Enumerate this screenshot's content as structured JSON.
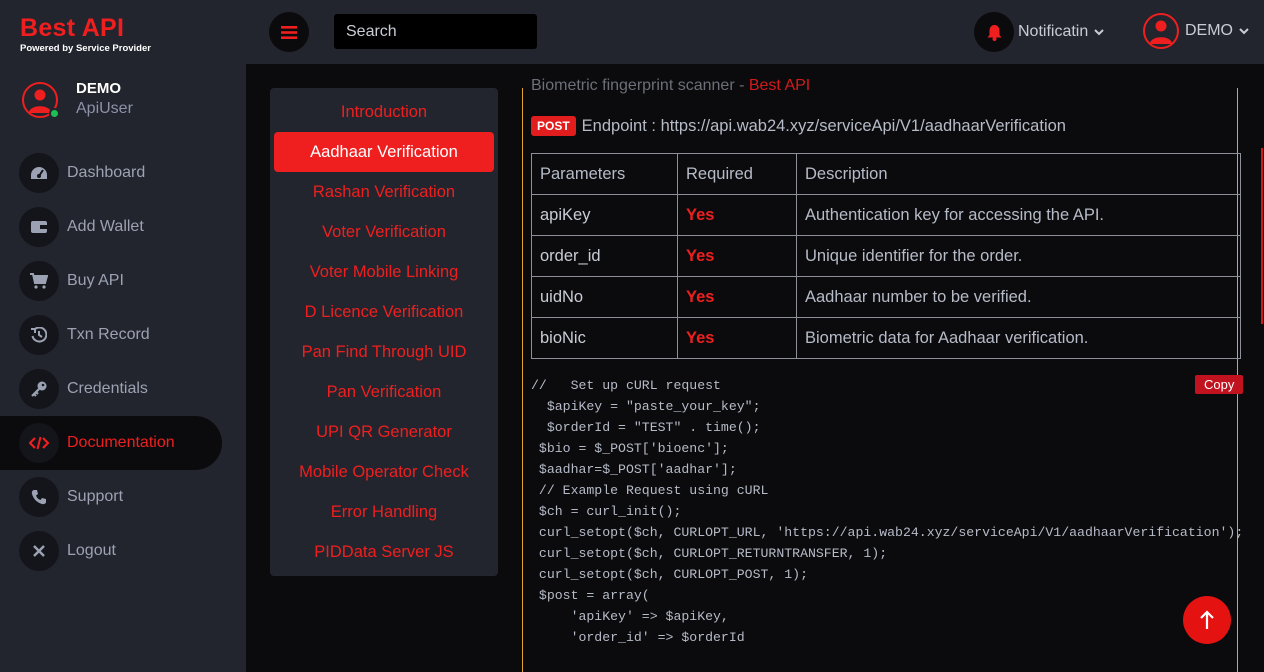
{
  "brand": {
    "title": "Best API",
    "subtitle": "Powered by Service Provider"
  },
  "user": {
    "name": "DEMO",
    "role": "ApiUser"
  },
  "sidebar": {
    "items": [
      {
        "label": "Dashboard",
        "icon": "dashboard-icon"
      },
      {
        "label": "Add Wallet",
        "icon": "wallet-icon"
      },
      {
        "label": "Buy API",
        "icon": "cart-icon"
      },
      {
        "label": "Txn Record",
        "icon": "history-icon"
      },
      {
        "label": "Credentials",
        "icon": "key-icon"
      },
      {
        "label": "Documentation",
        "icon": "code-icon",
        "active": true
      },
      {
        "label": "Support",
        "icon": "phone-icon"
      },
      {
        "label": "Logout",
        "icon": "close-icon"
      }
    ]
  },
  "topbar": {
    "search_placeholder": "Search",
    "notification_label": "Notificatin",
    "account_label": "DEMO"
  },
  "doc_nav": {
    "items": [
      "Introduction",
      "Aadhaar Verification",
      "Rashan Verification",
      "Voter Verification",
      "Voter Mobile Linking",
      "D Licence Verification",
      "Pan Find Through UID",
      "Pan Verification",
      "UPI QR Generator",
      "Mobile Operator Check",
      "Error Handling",
      "PIDData Server JS"
    ],
    "active_index": 1
  },
  "content": {
    "faded_text": "Biometric fingerprint scanner - ",
    "faded_brand": "Best API",
    "method": "POST",
    "endpoint": "Endpoint : https://api.wab24.xyz/serviceApi/V1/aadhaarVerification",
    "table": {
      "headers": [
        "Parameters",
        "Required",
        "Description"
      ],
      "rows": [
        [
          "apiKey",
          "Yes",
          "Authentication key for accessing the API."
        ],
        [
          "order_id",
          "Yes",
          "Unique identifier for the order."
        ],
        [
          "uidNo",
          "Yes",
          "Aadhaar number to be verified."
        ],
        [
          "bioNic",
          "Yes",
          "Biometric data for Aadhaar verification."
        ]
      ]
    },
    "copy_label": "Copy",
    "code": "//   Set up cURL request\n  $apiKey = \"paste_your_key\";\n  $orderId = \"TEST\" . time();\n $bio = $_POST['bioenc'];\n $aadhar=$_POST['aadhar'];\n // Example Request using cURL\n $ch = curl_init();\n curl_setopt($ch, CURLOPT_URL, 'https://api.wab24.xyz/serviceApi/V1/aadhaarVerification');\n curl_setopt($ch, CURLOPT_RETURNTRANSFER, 1);\n curl_setopt($ch, CURLOPT_POST, 1);\n $post = array(\n     'apiKey' => $apiKey,\n     'order_id' => $orderId"
  },
  "colors": {
    "accent": "#f01f1f",
    "sidebar_bg": "#22252d",
    "main_bg": "#0b0b0d",
    "divider": "#e4a32a",
    "online": "#1fbf57"
  }
}
